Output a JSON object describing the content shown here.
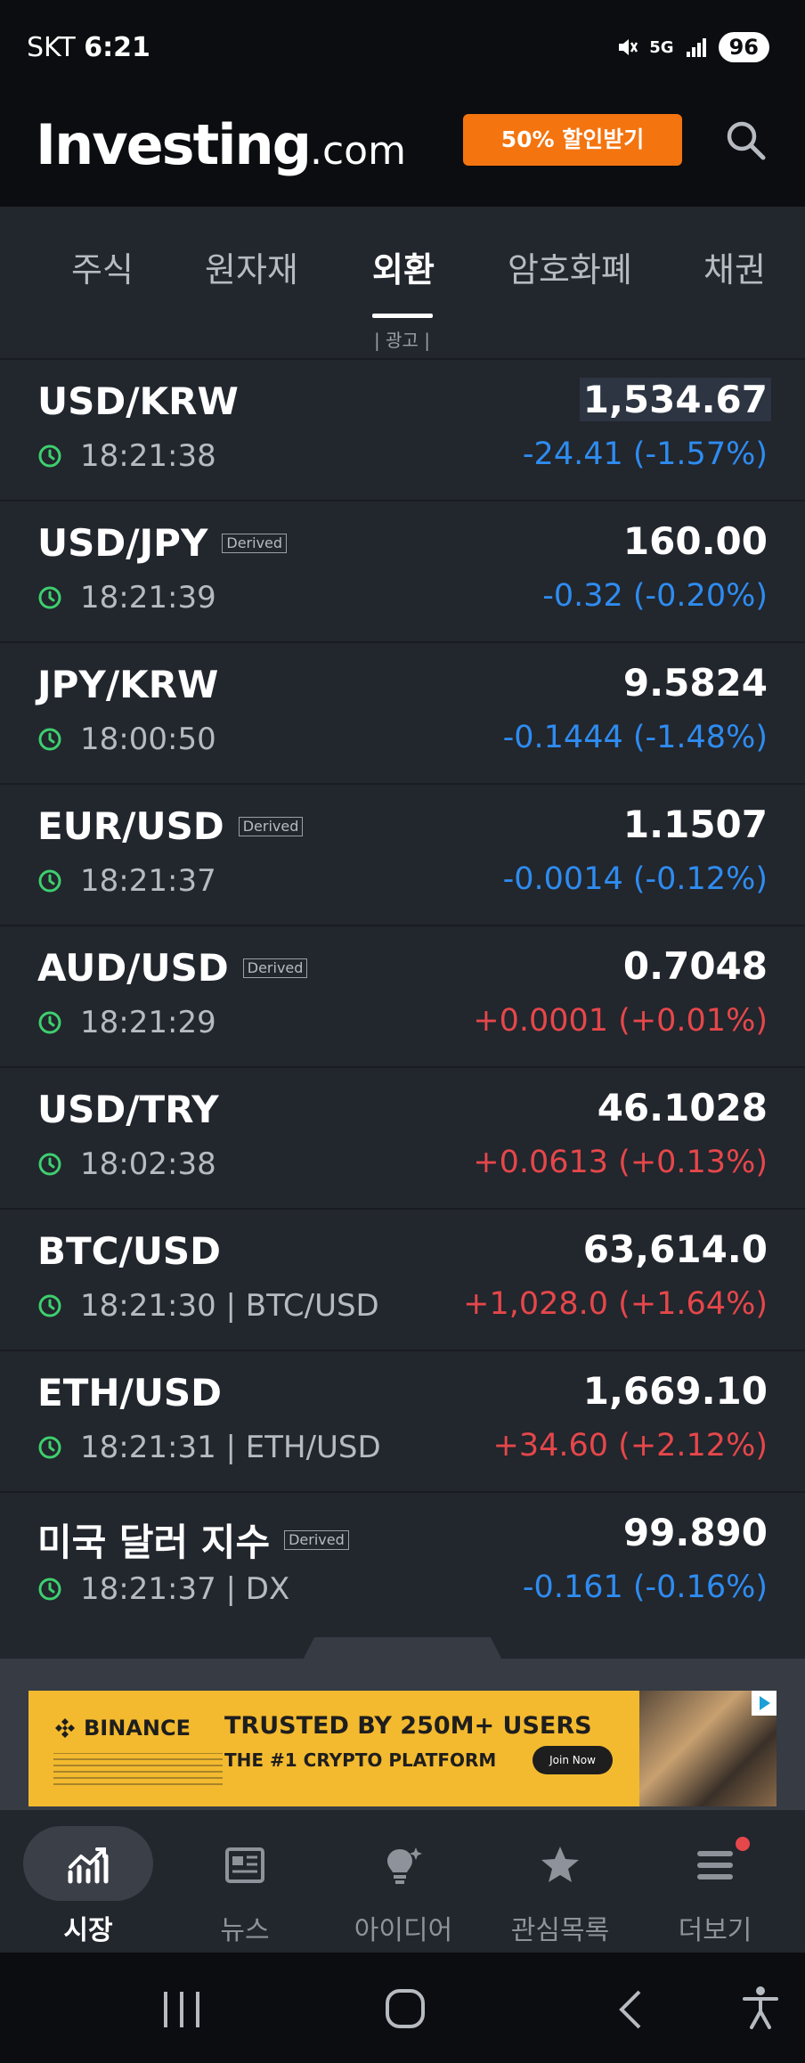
{
  "status_bar": {
    "carrier": "SKT",
    "time": "6:21",
    "network": "5G",
    "battery": "96"
  },
  "header": {
    "logo_main": "Investing",
    "logo_suffix": ".com",
    "promo_label": "50% 할인받기",
    "search_icon": "search-icon"
  },
  "tabs": {
    "items": [
      "주식",
      "원자재",
      "외환",
      "암호화폐",
      "채권"
    ],
    "active": "외환",
    "ad_label": "| 광고 |"
  },
  "rows": [
    {
      "symbol": "USD/KRW",
      "derived": "",
      "time": "18:21:38",
      "price": "1,534.67",
      "change": "-24.41 (-1.57%)",
      "direction": "down"
    },
    {
      "symbol": "USD/JPY",
      "derived": "Derived",
      "time": "18:21:39",
      "price": "160.00",
      "change": "-0.32 (-0.20%)",
      "direction": "down"
    },
    {
      "symbol": "JPY/KRW",
      "derived": "",
      "time": "18:00:50",
      "price": "9.5824",
      "change": "-0.1444 (-1.48%)",
      "direction": "down"
    },
    {
      "symbol": "EUR/USD",
      "derived": "Derived",
      "time": "18:21:37",
      "price": "1.1507",
      "change": "-0.0014 (-0.12%)",
      "direction": "down"
    },
    {
      "symbol": "AUD/USD",
      "derived": "Derived",
      "time": "18:21:29",
      "price": "0.7048",
      "change": "+0.0001 (+0.01%)",
      "direction": "up"
    },
    {
      "symbol": "USD/TRY",
      "derived": "",
      "time": "18:02:38",
      "price": "46.1028",
      "change": "+0.0613 (+0.13%)",
      "direction": "up"
    },
    {
      "symbol": "BTC/USD",
      "derived": "",
      "time": "18:21:30 | BTC/USD",
      "price": "63,614.0",
      "change": "+1,028.0 (+1.64%)",
      "direction": "up"
    },
    {
      "symbol": "ETH/USD",
      "derived": "",
      "time": "18:21:31 | ETH/USD",
      "price": "1,669.10",
      "change": "+34.60 (+2.12%)",
      "direction": "up"
    },
    {
      "symbol": "미국 달러 지수",
      "derived": "Derived",
      "time": "18:21:37 | DX",
      "price": "99.890",
      "change": "-0.161 (-0.16%)",
      "direction": "down"
    }
  ],
  "ad_banner": {
    "brand": "BINANCE",
    "headline": "TRUSTED BY 250M+ USERS",
    "subline": "THE #1 CRYPTO PLATFORM",
    "cta": "Join Now"
  },
  "bottom_nav": {
    "items": [
      "시장",
      "뉴스",
      "아이디어",
      "관심목록",
      "더보기"
    ],
    "active": "시장"
  },
  "colors": {
    "negative": "#2e8cf0",
    "positive": "#e5474a",
    "promo": "#f4740f",
    "background": "#22262d"
  }
}
